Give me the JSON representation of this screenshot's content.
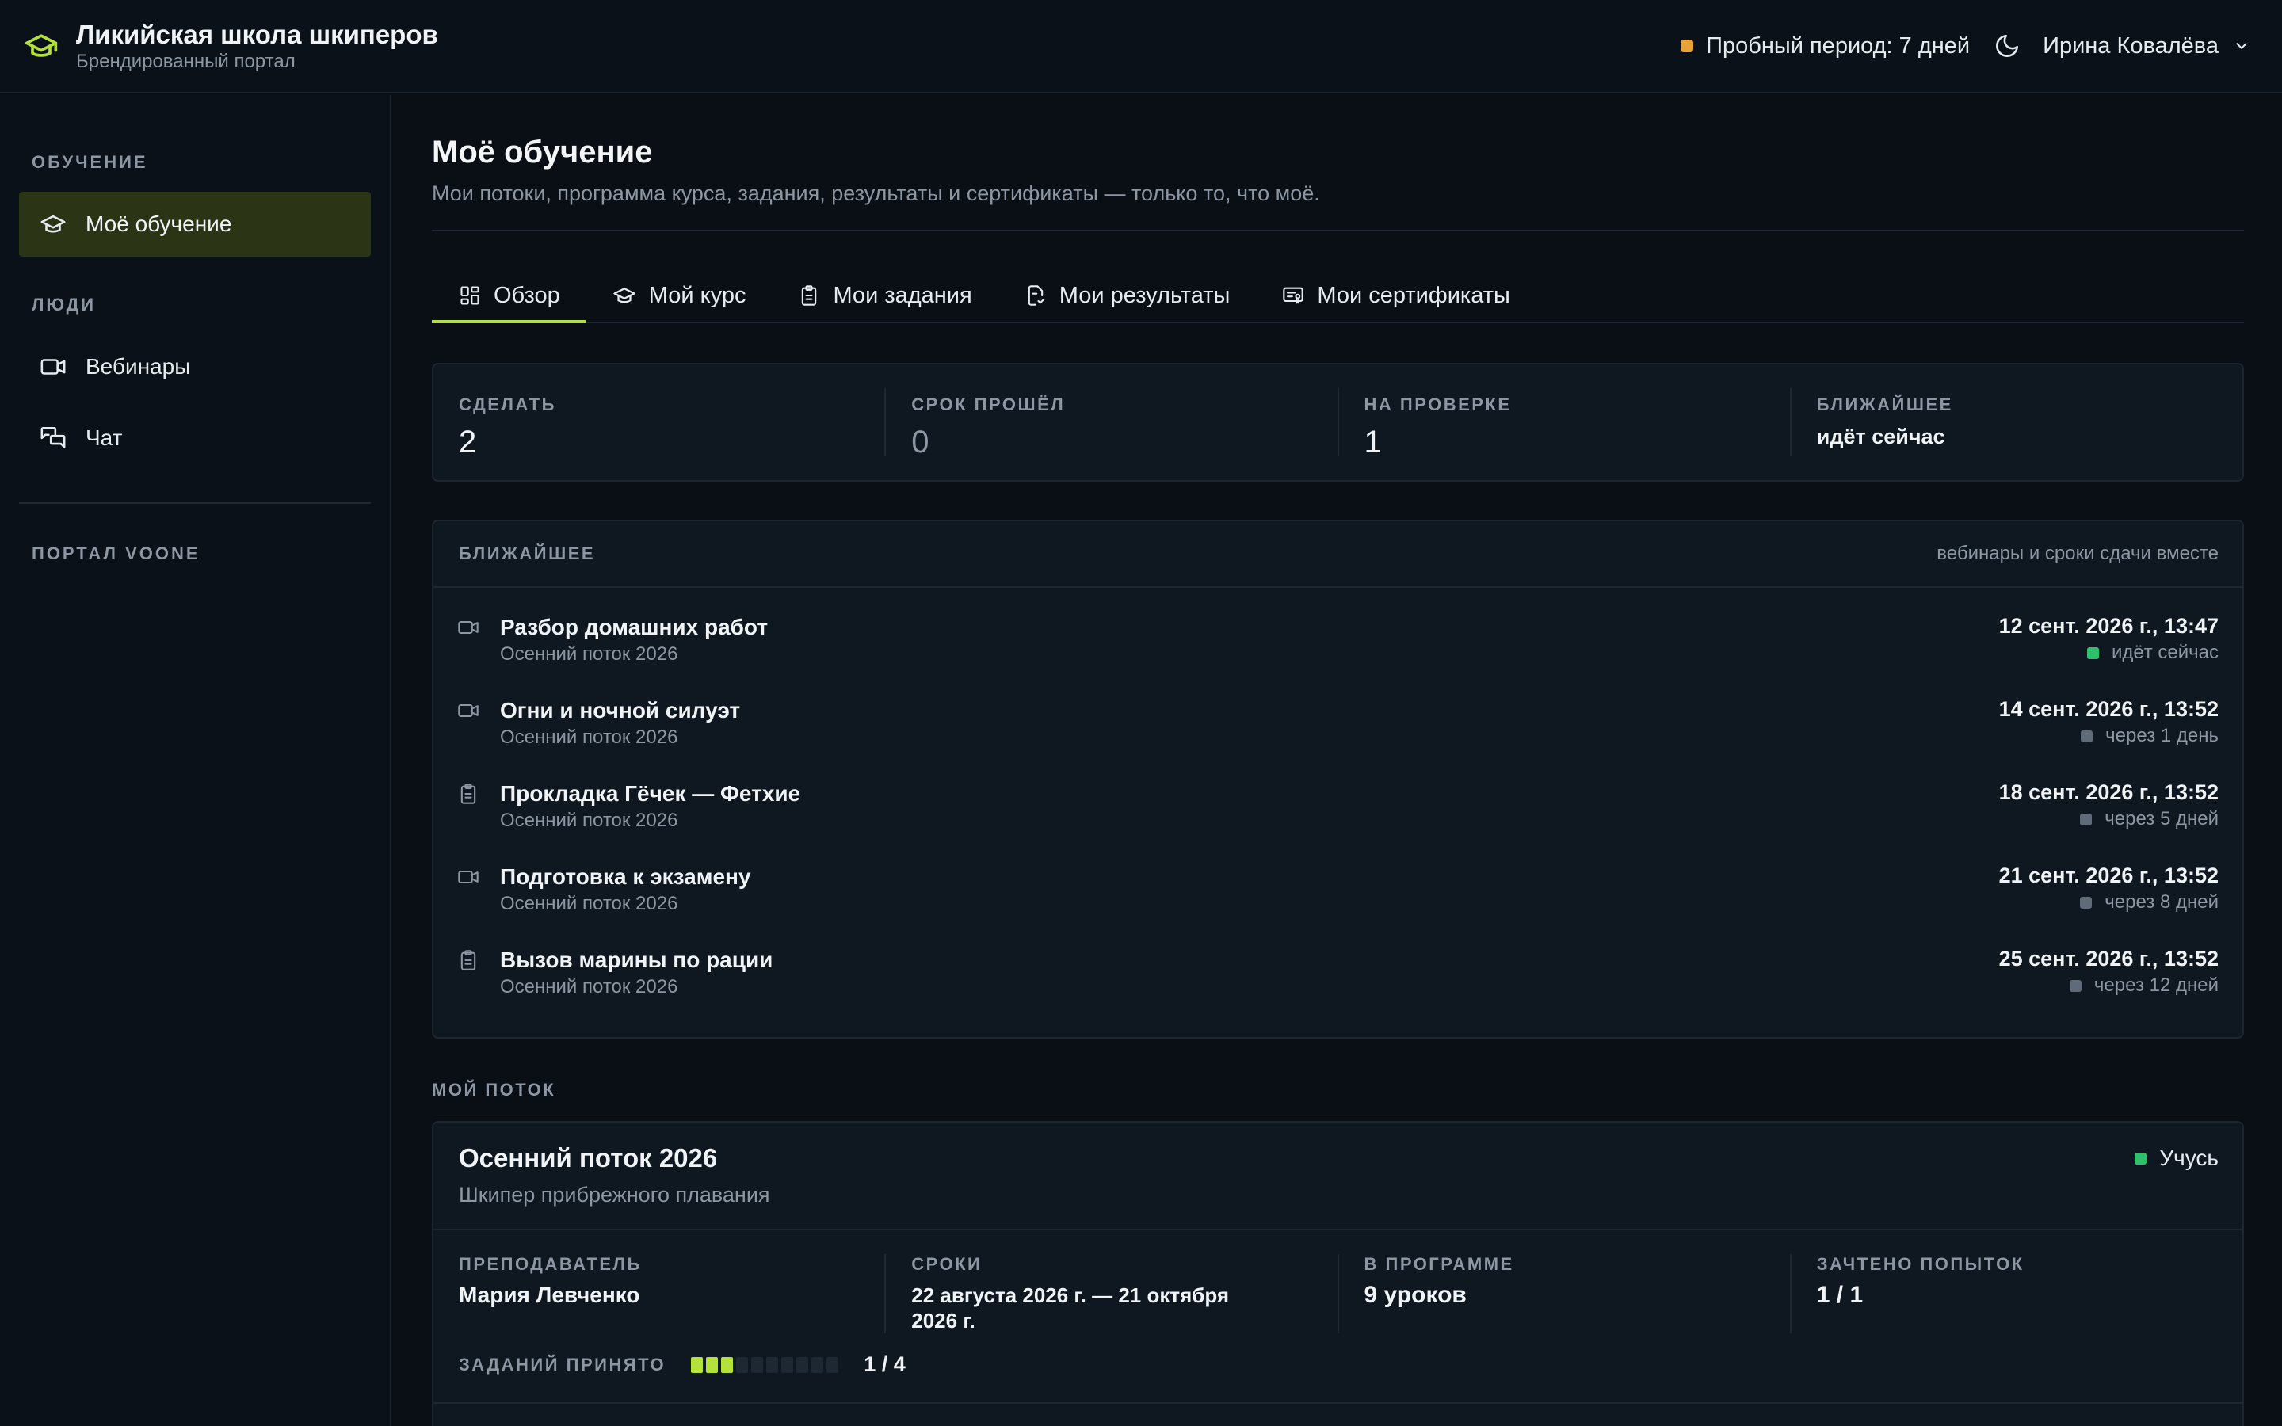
{
  "header": {
    "brand_title": "Ликийская школа шкиперов",
    "brand_subtitle": "Брендированный портал",
    "trial_text": "Пробный период: 7 дней",
    "user_name": "Ирина Ковалёва"
  },
  "colors": {
    "accent": "#b4e23a",
    "trial_dot": "#e8a23a",
    "live_status": "#2fc06b",
    "active_nav_bg": "#2b3415"
  },
  "sidebar": {
    "section_learning": "ОБУЧЕНИЕ",
    "item_my_learning": "Моё обучение",
    "section_people": "ЛЮДИ",
    "item_webinars": "Вебинары",
    "item_chat": "Чат",
    "section_portal": "ПОРТАЛ VOONE"
  },
  "page": {
    "title": "Моё обучение",
    "subtitle": "Мои потоки, программа курса, задания, результаты и сертификаты — только то, что моё."
  },
  "tabs": [
    {
      "label": "Обзор",
      "icon": "grid-icon",
      "active": true
    },
    {
      "label": "Мой курс",
      "icon": "graduation-cap-icon",
      "active": false
    },
    {
      "label": "Мои задания",
      "icon": "clipboard-icon",
      "active": false
    },
    {
      "label": "Мои результаты",
      "icon": "result-doc-icon",
      "active": false
    },
    {
      "label": "Мои сертификаты",
      "icon": "certificate-icon",
      "active": false
    }
  ],
  "stats": [
    {
      "label": "СДЕЛАТЬ",
      "value": "2"
    },
    {
      "label": "СРОК ПРОШЁЛ",
      "value": "0"
    },
    {
      "label": "НА ПРОВЕРКЕ",
      "value": "1"
    },
    {
      "label": "БЛИЖАЙШЕЕ",
      "value": "идёт сейчас"
    }
  ],
  "upcoming": {
    "title": "БЛИЖАЙШЕЕ",
    "note": "вебинары и сроки сдачи вместе",
    "items": [
      {
        "icon": "video-icon",
        "title": "Разбор домашних работ",
        "subtitle": "Осенний поток 2026",
        "date": "12 сент. 2026 г., 13:47",
        "status": "идёт сейчас",
        "live": true
      },
      {
        "icon": "video-icon",
        "title": "Огни и ночной силуэт",
        "subtitle": "Осенний поток 2026",
        "date": "14 сент. 2026 г., 13:52",
        "status": "через 1 день",
        "live": false
      },
      {
        "icon": "clipboard-icon",
        "title": "Прокладка Гёчек — Фетхие",
        "subtitle": "Осенний поток 2026",
        "date": "18 сент. 2026 г., 13:52",
        "status": "через 5 дней",
        "live": false
      },
      {
        "icon": "video-icon",
        "title": "Подготовка к экзамену",
        "subtitle": "Осенний поток 2026",
        "date": "21 сент. 2026 г., 13:52",
        "status": "через 8 дней",
        "live": false
      },
      {
        "icon": "clipboard-icon",
        "title": "Вызов марины по рации",
        "subtitle": "Осенний поток 2026",
        "date": "25 сент. 2026 г., 13:52",
        "status": "через 12 дней",
        "live": false
      }
    ]
  },
  "stream": {
    "section_label": "МОЙ ПОТОК",
    "title": "Осенний поток 2026",
    "subtitle": "Шкипер прибрежного плавания",
    "status": "Учусь",
    "teacher_label": "ПРЕПОДАВАТЕЛЬ",
    "teacher_value": "Мария Левченко",
    "dates_label": "СРОКИ",
    "dates_value": "22 августа 2026 г. — 21 октября 2026 г.",
    "program_label": "В ПРОГРАММЕ",
    "program_value": "9 уроков",
    "attempts_label": "ЗАЧТЕНО ПОПЫТОК",
    "attempts_value": "1 / 1",
    "accepted_label": "ЗАДАНИЙ ПРИНЯТО",
    "accepted_value": "1 / 4",
    "accepted_fraction": 0.25
  }
}
